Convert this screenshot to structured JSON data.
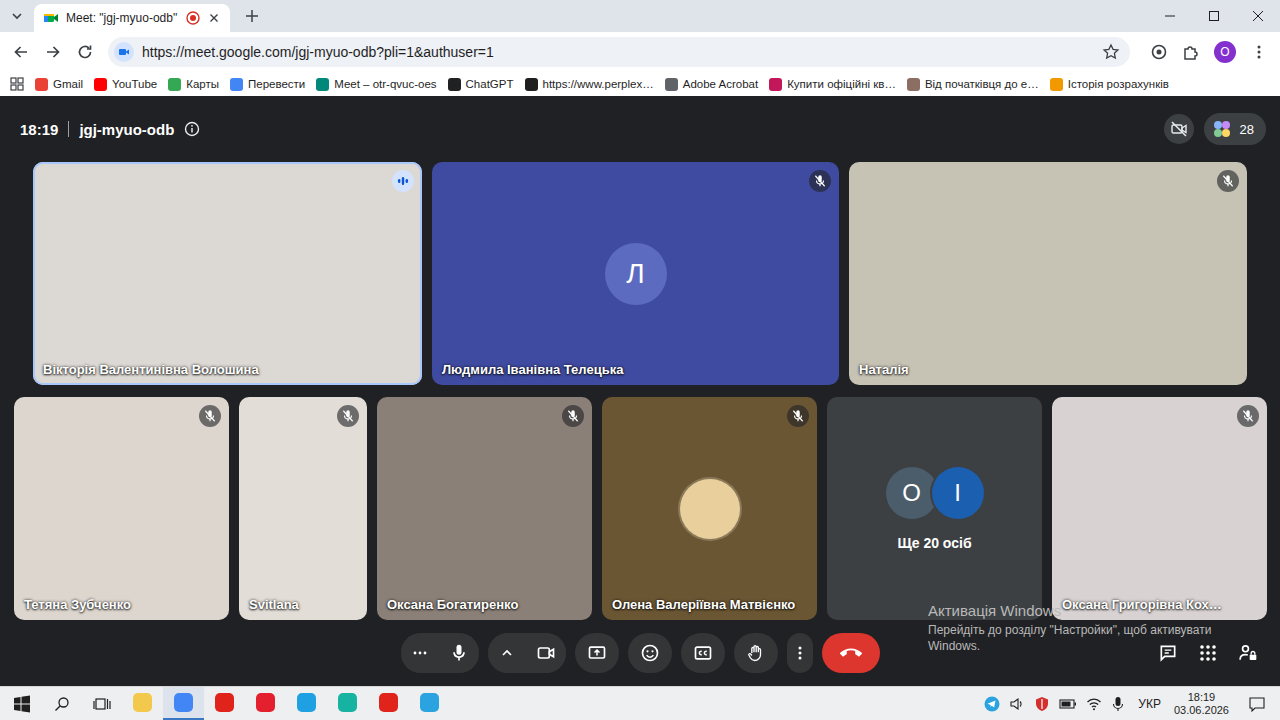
{
  "browser": {
    "tab": {
      "title": "Meet: \"jgj-myuo-odb\"",
      "recording": true,
      "selected": true
    },
    "url": "https://meet.google.com/jgj-myuo-odb?pli=1&authuser=1",
    "bookmarked": false,
    "profile": "O",
    "bookmarks": [
      {
        "label": "Gmail",
        "color": "#ea4335"
      },
      {
        "label": "YouTube",
        "color": "#ff0000"
      },
      {
        "label": "Карты",
        "color": "#34a853"
      },
      {
        "label": "Перевести",
        "color": "#4285f4"
      },
      {
        "label": "Meet – otr-qvuc-oes",
        "color": "#00897b"
      },
      {
        "label": "ChatGPT",
        "color": "#202123"
      },
      {
        "label": "https://www.perplex…",
        "color": "#1f1f1f"
      },
      {
        "label": "Adobe Acrobat",
        "color": "#5f6368"
      },
      {
        "label": "Купити офіційні кв…",
        "color": "#c2185b"
      },
      {
        "label": "Від початківця до е…",
        "color": "#8d6e63"
      },
      {
        "label": "Історія розрахунків",
        "color": "#f29900"
      }
    ]
  },
  "meet": {
    "time": "18:19",
    "code": "jgj-myuo-odb",
    "camera_off": true,
    "participants_count": "28",
    "rows": [
      [
        {
          "kind": "video",
          "name": "Вікторія Валентинівна Волошина",
          "muted": false,
          "speaking": true,
          "color": "#dcd8d3"
        },
        {
          "kind": "avatar",
          "name": "Людмила Іванівна Телецька",
          "muted": true,
          "speaking": false,
          "color": "#3f4ba0",
          "letter": "Л",
          "avatar_color": "#5c6bc0"
        },
        {
          "kind": "video",
          "name": "Наталія",
          "muted": true,
          "speaking": false,
          "color": "#c6c2b4"
        }
      ],
      [
        {
          "kind": "video",
          "name": "Тетяна Зубченко",
          "muted": true,
          "speaking": false,
          "color": "#ddd6cf"
        },
        {
          "kind": "video",
          "name": "Svitlana",
          "muted": true,
          "speaking": false,
          "color": "#e2ddd6"
        },
        {
          "kind": "video",
          "name": "Оксана Богатиренко",
          "muted": true,
          "speaking": false,
          "color": "#8b8078"
        },
        {
          "kind": "photo",
          "name": "Олена Валеріївна Матвієнко",
          "muted": true,
          "speaking": false,
          "color": "#6b5634",
          "avatar_color": "#e9cf9c"
        },
        {
          "kind": "more",
          "label": "Ще 20 осіб",
          "color": "#3c4043",
          "avatars": [
            {
              "letter": "O",
              "color": "#4b5d6b"
            },
            {
              "letter": "I",
              "color": "#1b5fb0"
            }
          ]
        },
        {
          "kind": "video",
          "name": "Оксана Григорівна Кох…",
          "muted": true,
          "speaking": false,
          "color": "#d8d3d2"
        }
      ]
    ]
  },
  "watermark": {
    "title": "Активація Windows",
    "text": "Перейдіть до розділу \"Настройки\", щоб активувати Windows."
  },
  "taskbar": {
    "apps": [
      {
        "color": "#f2c94c",
        "active": false
      },
      {
        "color": "#4285f4",
        "active": true
      },
      {
        "color": "#e0241b",
        "active": false
      },
      {
        "color": "#e5202e",
        "active": false
      },
      {
        "color": "#1fa0e3",
        "active": false
      },
      {
        "color": "#16b3a3",
        "active": false
      },
      {
        "color": "#e0241b",
        "active": false
      },
      {
        "color": "#2aa3e0",
        "active": false
      }
    ],
    "language": "УКР",
    "time": "18:19",
    "date": "03.06.2026"
  }
}
